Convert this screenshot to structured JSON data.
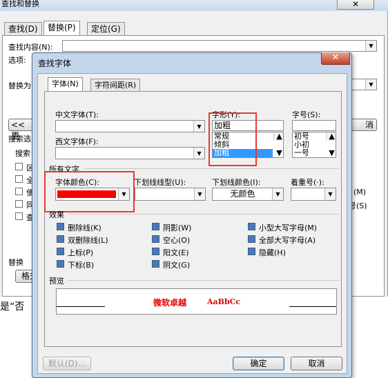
{
  "back": {
    "title": "查找和替换",
    "close": "✕",
    "tabs": [
      "查找(D)",
      "替换(P)",
      "定位(G)"
    ],
    "find_label": "查找内容(N):",
    "options_label": "选项:",
    "replace_label": "替换为",
    "less_button": "<< 更",
    "search_opts_label": "搜索选",
    "search_label": "搜索",
    "partial_labels": [
      "区",
      "全",
      "使",
      "同",
      "查"
    ],
    "right_partial": [
      "(M)",
      "号(S)"
    ],
    "replace_section": "替换",
    "format_button": "格式",
    "cancel_partial": "消",
    "bottom_text": "是“否"
  },
  "dialog": {
    "title": "查找字体",
    "close": "✕",
    "tabs": [
      "字体(N)",
      "字符间距(R)"
    ],
    "chinese_font_label": "中文字体(T):",
    "western_font_label": "西文字体(F):",
    "style_label": "字形(Y):",
    "style_value": "加粗",
    "style_options": [
      "常规",
      "倾斜",
      "加粗"
    ],
    "size_label": "字号(S):",
    "size_options": [
      "初号",
      "小初",
      "一号"
    ],
    "all_text_label": "所有文字",
    "font_color_label": "字体颜色(C):",
    "font_color_value": "#ff0000",
    "underline_type_label": "下划线线型(U):",
    "underline_color_label": "下划线颜色(I):",
    "underline_color_value": "无颜色",
    "emphasis_label": "着重号(·):",
    "effects_label": "效果",
    "effects": [
      {
        "label": "删除线(K)"
      },
      {
        "label": "双删除线(L)"
      },
      {
        "label": "上标(P)"
      },
      {
        "label": "下标(B)"
      },
      {
        "label": "阴影(W)"
      },
      {
        "label": "空心(O)"
      },
      {
        "label": "阳文(E)"
      },
      {
        "label": "阴文(G)"
      },
      {
        "label": "小型大写字母(M)"
      },
      {
        "label": "全部大写字母(A)"
      },
      {
        "label": "隐藏(H)"
      }
    ],
    "preview_label": "预览",
    "preview_cn": "微软卓越",
    "preview_en": "AaBbCc",
    "default_button": "默认(D)...",
    "ok_button": "确定",
    "cancel_button": "取消"
  }
}
